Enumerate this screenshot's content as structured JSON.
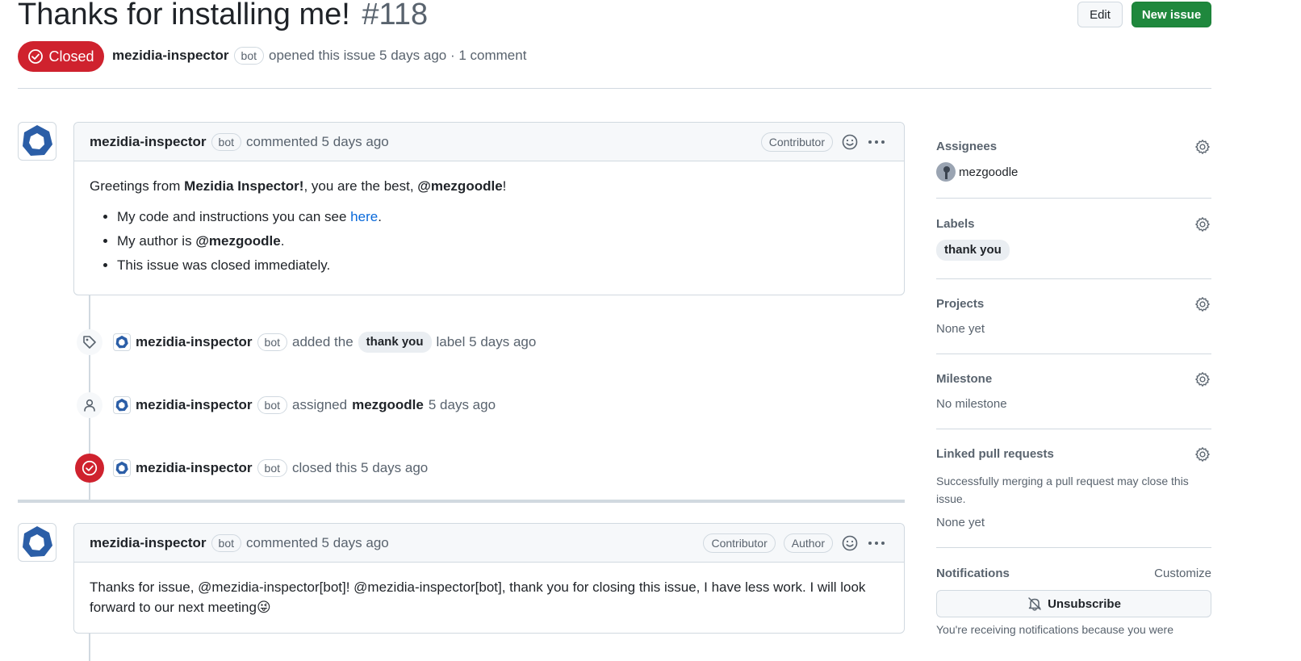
{
  "issue": {
    "title": "Thanks for installing me!",
    "number": "#118",
    "state": "Closed",
    "author": "mezidia-inspector",
    "bot_badge": "bot",
    "opened_text": "opened this issue 5 days ago · 1 comment"
  },
  "header_buttons": {
    "edit": "Edit",
    "new_issue": "New issue"
  },
  "comment1": {
    "author": "mezidia-inspector",
    "bot_badge": "bot",
    "time": "commented 5 days ago",
    "role": "Contributor",
    "greeting_pre": "Greetings from ",
    "greeting_bold": "Mezidia Inspector!",
    "greeting_mid": ", you are the best, ",
    "greeting_mention": "@mezgoodle",
    "greeting_end": "!",
    "bullet1_pre": "My code and instructions you can see ",
    "bullet1_link": "here",
    "bullet1_end": ".",
    "bullet2_pre": "My author is ",
    "bullet2_mention": "@mezgoodle",
    "bullet2_end": ".",
    "bullet3": "This issue was closed immediately."
  },
  "events": [
    {
      "actor": "mezidia-inspector",
      "badge": "bot",
      "pre": "added the",
      "label": "thank you",
      "post": "label 5 days ago"
    },
    {
      "actor": "mezidia-inspector",
      "badge": "bot",
      "pre": "assigned",
      "target": "mezgoodle",
      "post": "5 days ago"
    },
    {
      "actor": "mezidia-inspector",
      "badge": "bot",
      "pre": "closed this 5 days ago"
    }
  ],
  "comment2": {
    "author": "mezidia-inspector",
    "bot_badge": "bot",
    "time": "commented 5 days ago",
    "role1": "Contributor",
    "role2": "Author",
    "body_line1": "Thanks for issue, @mezidia-inspector[bot]! @mezidia-inspector[bot], thank you for closing this issue, I have less work. I will look",
    "body_line2": "forward to our next meeting",
    "emoji": "😜"
  },
  "sidebar": {
    "assignees_title": "Assignees",
    "assignee": "mezgoodle",
    "labels_title": "Labels",
    "label": "thank you",
    "projects_title": "Projects",
    "projects_value": "None yet",
    "milestone_title": "Milestone",
    "milestone_value": "No milestone",
    "linked_title": "Linked pull requests",
    "linked_desc_1": "Successfully merging a pull request may close this",
    "linked_desc_2": "issue.",
    "linked_value": "None yet",
    "notifications_title": "Notifications",
    "customize": "Customize",
    "unsubscribe": "Unsubscribe",
    "notif_reason": "You're receiving notifications because you were"
  },
  "colors": {
    "closed": "#cf222e",
    "primary": "#1f883d",
    "link": "#0969da",
    "bot_logo": "#2b5ea7"
  }
}
